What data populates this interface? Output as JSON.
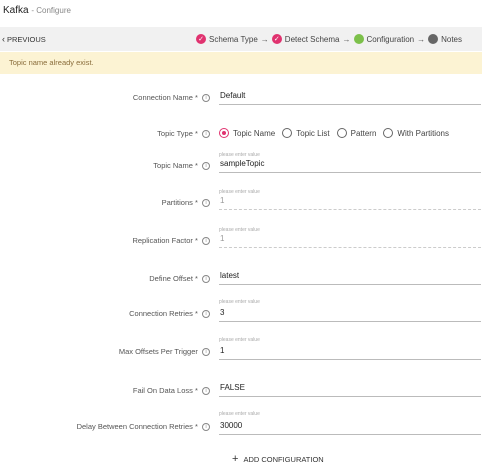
{
  "header": {
    "title": "Kafka",
    "subtitle": "- Configure"
  },
  "nav": {
    "previous": "PREVIOUS",
    "steps": [
      {
        "label": "Schema Type",
        "state": "done",
        "color": "#e0326f"
      },
      {
        "label": "Detect Schema",
        "state": "done",
        "color": "#e0326f"
      },
      {
        "label": "Configuration",
        "state": "current",
        "color": "#7cc04a"
      },
      {
        "label": "Notes",
        "state": "pending",
        "color": "#666666"
      }
    ],
    "arrow": "→",
    "check": "✓"
  },
  "alert": {
    "message": "Topic name already exist."
  },
  "form": {
    "connection_name": {
      "label": "Connection Name *",
      "value": "Default"
    },
    "topic_type": {
      "label": "Topic Type *",
      "options": [
        "Topic Name",
        "Topic List",
        "Pattern",
        "With Partitions"
      ],
      "selected": "Topic Name"
    },
    "topic_name": {
      "label": "Topic Name *",
      "hint": "please enter value",
      "value": "sampleTopic"
    },
    "partitions": {
      "label": "Partitions *",
      "hint": "please enter value",
      "value": "1"
    },
    "replication_factor": {
      "label": "Replication Factor *",
      "hint": "please enter value",
      "value": "1"
    },
    "define_offset": {
      "label": "Define Offset *",
      "value": "latest"
    },
    "connection_retries": {
      "label": "Connection Retries *",
      "hint": "please enter value",
      "value": "3"
    },
    "max_offsets": {
      "label": "Max Offsets Per Trigger",
      "hint": "please enter value",
      "value": "1"
    },
    "fail_on_data_loss": {
      "label": "Fail On Data Loss *",
      "value": "FALSE"
    },
    "delay_between_retries": {
      "label": "Delay Between Connection Retries *",
      "hint": "please enter value",
      "value": "30000"
    }
  },
  "add_configuration": "ADD CONFIGURATION"
}
